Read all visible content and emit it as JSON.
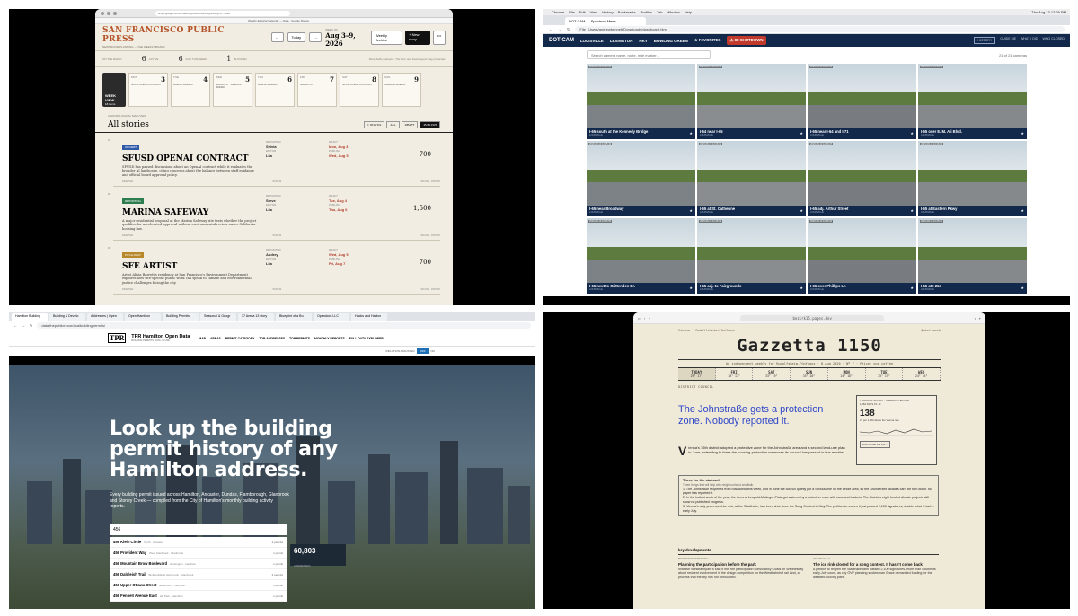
{
  "q1": {
    "url": "script.google.com/a/macros/publicpress.org/s/AKfycb.../exec",
    "bookmarks": "Weekly Editorial Calendar — Data · Google Sheets",
    "logo": "SAN FRANCISCO PUBLIC PRESS",
    "logo_sub": "NEWSROOM PLANNING — THE WEEKLY BOARD",
    "today_label": "Today",
    "week_label": "WEEK OF",
    "week": "Aug 3–9, 2026",
    "weekly_archive_label": "Weekly Archive",
    "new_story_label": "+ New story",
    "stats": [
      {
        "label": "ON THE RADIO",
        "value": ""
      },
      {
        "label": "ACTIVE",
        "value": "6"
      },
      {
        "label": "DUE THIS WEEK",
        "value": "6"
      },
      {
        "label": "BLOCKED",
        "value": "1"
      }
    ],
    "stats_note": "Story fields autosave. The form and board layout may protected.",
    "weekview": {
      "label": "WEEK VIEW",
      "sub": "18 items"
    },
    "days": [
      {
        "dow": "MON",
        "num": "3",
        "entry": "SFUSD OPENAI CONTRACT"
      },
      {
        "dow": "TUE",
        "num": "4",
        "entry": "MARINA SAFEWAY"
      },
      {
        "dow": "WED",
        "num": "5",
        "entry": "SFE ARTIST · VALENCIA BIKEWAY"
      },
      {
        "dow": "THU",
        "num": "6",
        "entry": "MARINA SAFEWAY"
      },
      {
        "dow": "FRI",
        "num": "7",
        "entry": "SFE ARTIST"
      },
      {
        "dow": "SAT",
        "num": "8",
        "entry": "SFUSD OPENAI CONTRACT"
      },
      {
        "dow": "SUN",
        "num": "9",
        "entry": "VALENCIA BIKEWAY"
      }
    ],
    "all_stories_kicker": "CHRONOLOGICAL MAIN VIEW",
    "all_stories": "All stories",
    "filters": [
      "1 STATUS",
      "ALL",
      "DRAFT",
      "PUBLISH"
    ],
    "stories": [
      {
        "idx": "01",
        "section": "ON DEBT",
        "sec_color": "#2f5aa8",
        "title": "SFUSD OPENAI CONTRACT",
        "dek": "SFUSD has passed discussions about an OpenAI contract while it evaluates the broader AI landscape, citing concerns about the balance between staff guidance and official board approval policy.",
        "reporter_lbl": "REPORTER",
        "reporter": "Sylvia",
        "editor_lbl": "EDITOR",
        "editor": "Lila",
        "draft_lbl": "DRAFT",
        "draft": "Mon, Aug 3",
        "pub_lbl": "PUBLISH",
        "pub": "Wed, Aug 5",
        "words": "700",
        "words_lbl": "WORDS",
        "foot_l": "DRAFTED",
        "foot_m": "STATUS",
        "foot_r": "SOCIAL · PROMO"
      },
      {
        "idx": "02",
        "section": "REPORTING",
        "sec_color": "#2e7d4f",
        "title": "MARINA SAFEWAY",
        "dek": "A major residential proposal at the Marina Safeway site tests whether the project qualifies for accelerated approval without environmental review under California housing law.",
        "reporter_lbl": "REPORTER",
        "reporter": "Steve",
        "editor_lbl": "EDITOR",
        "editor": "Lila",
        "draft_lbl": "DRAFT",
        "draft": "Tue, Aug 4",
        "pub_lbl": "PUBLISH",
        "pub": "Thu, Aug 6",
        "words": "1,500",
        "words_lbl": "WORDS",
        "foot_l": "DRAFTED",
        "foot_m": "STATUS",
        "foot_r": "SOCIAL · PROMO"
      },
      {
        "idx": "03",
        "section": "PITCH AWAY",
        "sec_color": "#b8892b",
        "title": "SFE ARTIST",
        "dek": "Artist Alivia Barrett's residency at San Francisco's Environment Department explores how site-specific public work can speak to climate and environmental justice challenges facing the city.",
        "reporter_lbl": "REPORTER",
        "reporter": "Audrey",
        "editor_lbl": "EDITOR",
        "editor": "Lila",
        "draft_lbl": "DRAFT",
        "draft": "Wed, Aug 5",
        "pub_lbl": "PUBLISH",
        "pub": "Fri, Aug 7",
        "words": "700",
        "words_lbl": "WORDS",
        "foot_l": "DRAFTED",
        "foot_m": "STATUS",
        "foot_r": "SOCIAL · PROMO"
      }
    ]
  },
  "q2": {
    "mac_menu": [
      "Chrome",
      "File",
      "Edit",
      "View",
      "History",
      "Bookmarks",
      "Profiles",
      "Tab",
      "Window",
      "Help"
    ],
    "clock": "Thu Aug 13 12:26 PM",
    "tab": "DOT CAM — Spectrum Mese",
    "url": "/Users/andrewbennett/Downloads/dashboard.html",
    "url_prefix": "File",
    "logo": "DOT CAM",
    "nav": [
      "LOUISVILLE",
      "LEXINGTON",
      "NKY",
      "BOWLING GREEN",
      "★ FAVORITES"
    ],
    "shutdown": "⚠ 88 SHUTDOWN",
    "right_nav": [
      "HISTORY",
      "GUIDE ME",
      "WHAT I DID",
      "WHO CLOSED"
    ],
    "search_placeholder": "Search camera name, route, mile marker...",
    "count": "21 of 21 cameras",
    "cameras": [
      {
        "name": "I-65 south at the Kennedy Bridge",
        "city": "LOUISVILLE",
        "ts": "2026-08-13 12:26:10"
      },
      {
        "name": "I-64 near I-65",
        "city": "LOUISVILLE",
        "ts": "2026-08-13 12:25:58"
      },
      {
        "name": "I-65 near I-64 and I-71",
        "city": "LOUISVILLE",
        "ts": "2026-08-13 12:26:03"
      },
      {
        "name": "I-65 over E. M. Ali Blvd.",
        "city": "LOUISVILLE",
        "ts": "2026-08-13 12:26:12"
      },
      {
        "name": "I-65 near Broadway",
        "city": "LOUISVILLE",
        "ts": "2026-08-13 12:25:49"
      },
      {
        "name": "I-65 at St. Catherine",
        "city": "LOUISVILLE",
        "ts": "2026-08-13 12:26:01"
      },
      {
        "name": "I-65 adj. Arthur Street",
        "city": "LOUISVILLE",
        "ts": "2026-08-13 12:26:07"
      },
      {
        "name": "I-65 at Eastern Pkwy",
        "city": "LOUISVILLE",
        "ts": "2026-08-13 12:26:05"
      },
      {
        "name": "I-65 next to Crittenden Dr.",
        "city": "LOUISVILLE",
        "ts": "2026-08-13 12:25:55"
      },
      {
        "name": "I-65 adj. to Fairgrounds",
        "city": "LOUISVILLE",
        "ts": "2026-08-13 12:26:09"
      },
      {
        "name": "I-65 over Phillips Ln",
        "city": "LOUISVILLE",
        "ts": "2026-08-13 12:26:02"
      },
      {
        "name": "I-65 at I-264",
        "city": "LOUISVILLE",
        "ts": "2026-08-13 12:26:11"
      }
    ]
  },
  "q3": {
    "tabs": [
      "Hamilton Building",
      "Building & Develo",
      "Addresses | Open",
      "Open Hamilton",
      "Building Permits",
      "Seasonal & Geogr",
      "37 Arena 13 story",
      "Blueprint of a Bu",
      "Opendock LLC",
      "Hacks and Harbor"
    ],
    "url": "data.thepublicrecord.ca/buildingpermits/",
    "logo": "TPR",
    "title": "TPR Hamilton Open Data",
    "title_sub": "BUILDING PERMITS, DATA, IN USE",
    "menu": [
      "MAP",
      "AREAS",
      "PERMIT CATEGORY",
      "TOP ADDRESSES",
      "TOP PERMITS",
      "MONTHLY REPORTS",
      "FULL DATA EXPLORER"
    ],
    "lang_label": "INFLATION ADJUSTED",
    "lang_en": "YES",
    "lang_fr": "NO",
    "headline": "Look up the building permit history of any Hamilton address.",
    "para": "Every building permit issued across Hamilton, Ancaster, Dundas, Flamborough, Glanbrook and Stoney Creek — compiled from the City of Hamilton's monthly building activity reports.",
    "search_value": "456",
    "results": [
      {
        "addr": "456 Klein Circle",
        "area": "North · Ancaster",
        "permits": "2 permits"
      },
      {
        "addr": "456 Provident Way",
        "area": "West Glanbrook · Glanbrook",
        "permits": "1 permit"
      },
      {
        "addr": "456 Mountain Brow Boulevard",
        "area": "Huntington · Hamilton",
        "permits": "1 permit"
      },
      {
        "addr": "456 Dalgleish Trail",
        "area": "Binbrook/East Glanbrook · Glanbrook",
        "permits": "2 permits"
      },
      {
        "addr": "456 Upper Ottawa Street",
        "area": "Eastmount · Hamilton",
        "permits": "1 permit"
      },
      {
        "addr": "456 Fennell Avenue East",
        "area": "Hill Park · Hamilton",
        "permits": "1 permit"
      }
    ],
    "count_value": "60,803",
    "count_label": "ADDRESSES"
  },
  "q4": {
    "url": "bezirk15.pages.dev",
    "top_left": "Vienna · Rudolfsheim-Fünfhaus",
    "top_right": "Quiet week",
    "masthead": "Gazzetta 1150",
    "tagline": "An independent weekly for Rudolfsheim-Fünfhaus · 8 Aug 2026 · Nº 7 · Price: one coffee",
    "weather": [
      {
        "day": "TODAY",
        "t": "29° 17°"
      },
      {
        "day": "FRI",
        "t": "30° 17°"
      },
      {
        "day": "SAT",
        "t": "33° 19°"
      },
      {
        "day": "SUN",
        "t": "35° 20°"
      },
      {
        "day": "MON",
        "t": "24° 18°"
      },
      {
        "day": "TUE",
        "t": "25° 15°"
      },
      {
        "day": "WED",
        "t": "24° 16°"
      }
    ],
    "section": "DISTRICT COUNCIL",
    "headline": "The Johnstraße gets a protection zone. Nobody reported it.",
    "lede": "Vienna's 15th district adopted a protective zone for the Johnstraße area and a second land-use plan in June, extending to three the housing-protection measures its council has passed in five months.",
    "box_kicker": "TRACKING SLOWLY · UNEMPLOYED FEB",
    "box_sub": "1,084 DAYS 15→4",
    "box_value": "138",
    "box_note": "27 per 1,000 above the Vienna rate",
    "box_link": "How to read this link ↗",
    "stair_title": "Three for the stairwell",
    "stair_sub": "Three things that will help with neighbourhood smalltalk.",
    "stair_items": [
      "1. The Johnstraße reopened from roadworks this week, and in June the council quietly put a Schutzzone on the whole area, so the Gründerzeit facades can't be torn down. No paper has reported it.",
      "2. In the hottest week of the year, the trees at Leopold-Mistinger-Platz got watered by a volunteer crew with cans and buckets. The district's eight funded climate projects still show no published progress.",
      "3. Vienna's only year-round ice rink, at the Stadthalle, has been shut since the Song Contest in May. The petition to reopen it just passed 2,100 signatures, double what it had in early July."
    ],
    "kd_title": "key developments",
    "dev1": {
      "kicker": "BEZIRKSVERTRETUNG",
      "head": "Planning the participation before the park",
      "body": "Initiative Westbahnpark's said it met the participation consultancy Clusis on Wednesday about resident involvement in the design competition for the Westbahnhof rail land, a process that the city has not announced."
    },
    "dev2": {
      "kicker": "STADTHALLE",
      "head": "The ice rink closed for a song contest. It hasn't come back.",
      "body": "A petition to reopen the Stadthallebahn passed 2,100 signatures, more than double its early-July count, as city ÖVP planning spokesman Grace demanded funding for the disabled cooling plant."
    }
  }
}
